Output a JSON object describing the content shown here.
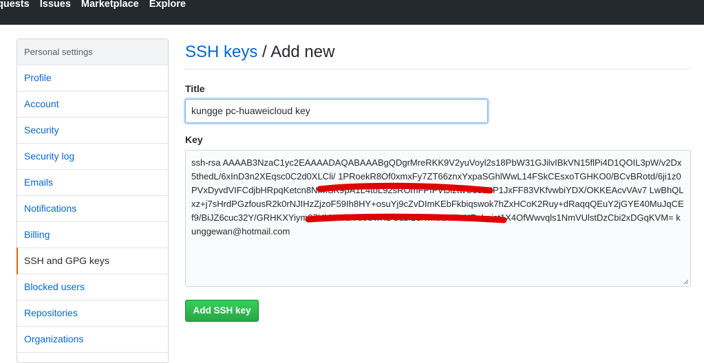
{
  "topnav": {
    "items": [
      "quests",
      "Issues",
      "Marketplace",
      "Explore"
    ]
  },
  "sidebar": {
    "header": "Personal settings",
    "items": [
      {
        "label": "Profile"
      },
      {
        "label": "Account"
      },
      {
        "label": "Security"
      },
      {
        "label": "Security log"
      },
      {
        "label": "Emails"
      },
      {
        "label": "Notifications"
      },
      {
        "label": "Billing"
      },
      {
        "label": "SSH and GPG keys",
        "selected": true
      },
      {
        "label": "Blocked users"
      },
      {
        "label": "Repositories"
      },
      {
        "label": "Organizations"
      }
    ]
  },
  "main": {
    "breadcrumb_link": "SSH keys",
    "separator": " / ",
    "heading": "Add new",
    "title_label": "Title",
    "title_value": "kungge pc-huaweicloud key",
    "key_label": "Key",
    "key_value": "ssh-rsa AAAAB3NzaC1yc2EAAAADAQABAAABgQDgrMreRKK9V2yuVoyl2s18PbW31GJilvIBkVN15flPi4D1QOIL3pW/v2Dx5thedL/6xInD3n2XEqsc0C2d0XLCli/                         1PRoekR8Of0xmxFy7ZT66znxYxpaSGhlWwL14FSkCEsxoTGHKO0/BCvBRotd/6ji1z0PVxDyvdVIFCdjbHRpqKetcn8NfMSK9pA1L4toL92sROmFPfFVtJiztwC00JKP1JxFF83VKfvwbiYDX/OKKEAcvVAv7                              LwBhQLxz+j7sHrdPGzfousR2k0rNJIHzZjzoF59Ih8HY+osuYj9cZvDImKEbFkbiqswok7hZxHCoK2Ruy+dRaqqQEuY2jGYE40MuJqCEf9/BiJZ6cuc32Y/GRHKXYiym87UkNIFfBYdcUwKDGzzf1S/wkCBSBcURxhpist1X4OfWwvqls1NmVUlstDzCbi2xDGqKVM= kunggewan@hotmail.com",
    "submit_label": "Add SSH key"
  },
  "colors": {
    "link": "#0366d6",
    "selected_accent": "#e36209",
    "button": "#28a745",
    "redaction": "#e00000"
  }
}
